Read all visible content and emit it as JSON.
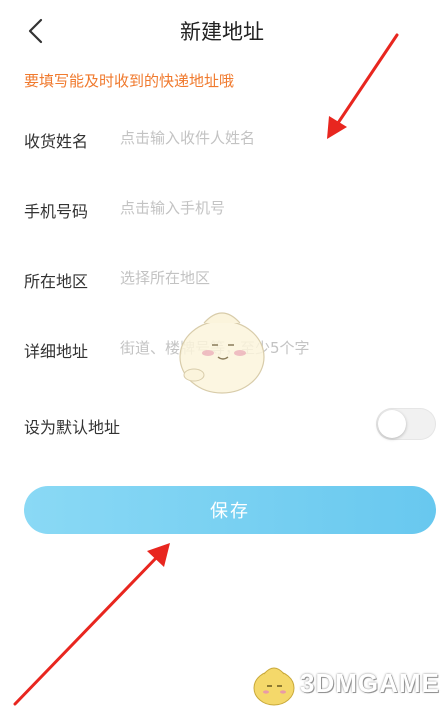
{
  "header": {
    "title": "新建地址",
    "back_icon": "chevron-left-icon"
  },
  "tip": "要填写能及时收到的快递地址哦",
  "form": {
    "name": {
      "label": "收货姓名",
      "placeholder": "点击输入收件人姓名"
    },
    "phone": {
      "label": "手机号码",
      "placeholder": "点击输入手机号"
    },
    "region": {
      "label": "所在地区",
      "placeholder": "选择所在地区"
    },
    "detail": {
      "label": "详细地址",
      "placeholder": "街道、楼牌号等，至少5个字"
    },
    "default": {
      "label": "设为默认地址",
      "enabled": false
    }
  },
  "save": {
    "label": "保存"
  },
  "watermark": {
    "text": "3DMGAME"
  },
  "colors": {
    "tip": "#f07a2e",
    "button_start": "#8ad9f5",
    "button_end": "#68c8ef",
    "annotation_arrow": "#e8261f"
  }
}
